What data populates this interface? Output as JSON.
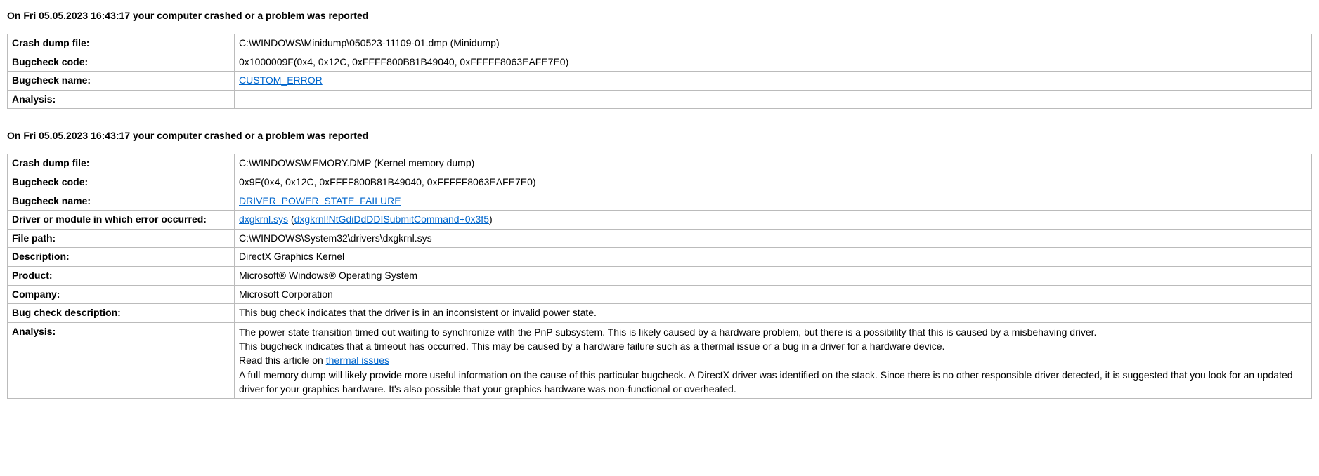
{
  "crash1": {
    "header": "On Fri 05.05.2023 16:43:17 your computer crashed or a problem was reported",
    "labels": {
      "dump_file": "Crash dump file:",
      "bugcheck_code": "Bugcheck code:",
      "bugcheck_name": "Bugcheck name:",
      "analysis": "Analysis:"
    },
    "values": {
      "dump_file": "C:\\WINDOWS\\Minidump\\050523-11109-01.dmp (Minidump)",
      "bugcheck_code": "0x1000009F(0x4, 0x12C, 0xFFFF800B81B49040, 0xFFFFF8063EAFE7E0)",
      "bugcheck_name": "CUSTOM_ERROR",
      "analysis": ""
    }
  },
  "crash2": {
    "header": "On Fri 05.05.2023 16:43:17 your computer crashed or a problem was reported",
    "labels": {
      "dump_file": "Crash dump file:",
      "bugcheck_code": "Bugcheck code:",
      "bugcheck_name": "Bugcheck name:",
      "driver_module": "Driver or module in which error occurred:",
      "file_path": "File path:",
      "description": "Description:",
      "product": "Product:",
      "company": "Company:",
      "bugcheck_desc": "Bug check description:",
      "analysis": "Analysis:"
    },
    "values": {
      "dump_file": "C:\\WINDOWS\\MEMORY.DMP (Kernel memory dump)",
      "bugcheck_code": "0x9F(0x4, 0x12C, 0xFFFF800B81B49040, 0xFFFFF8063EAFE7E0)",
      "bugcheck_name": "DRIVER_POWER_STATE_FAILURE",
      "driver_link1": "dxgkrnl.sys",
      "driver_paren_open": " (",
      "driver_link2": "dxgkrnl!NtGdiDdDDISubmitCommand+0x3f5",
      "driver_paren_close": ")",
      "file_path": "C:\\WINDOWS\\System32\\drivers\\dxgkrnl.sys",
      "description": "DirectX Graphics Kernel",
      "product": "Microsoft® Windows® Operating System",
      "company": "Microsoft Corporation",
      "bugcheck_desc": "This bug check indicates that the driver is in an inconsistent or invalid power state.",
      "analysis_p1": "The power state transition timed out waiting to synchronize with the PnP subsystem. This is likely caused by a hardware problem, but there is a possibility that this is caused by a misbehaving driver.",
      "analysis_p2": "This bugcheck indicates that a timeout has occurred. This may be caused by a hardware failure such as a thermal issue or a bug in a driver for a hardware device.",
      "analysis_p3a": "Read this article on ",
      "analysis_p3_link": "thermal issues",
      "analysis_p4": "A full memory dump will likely provide more useful information on the cause of this particular bugcheck. A DirectX driver was identified on the stack. Since there is no other responsible driver detected, it is suggested that you look for an updated driver for your graphics hardware. It's also possible that your graphics hardware was non-functional or overheated."
    }
  }
}
